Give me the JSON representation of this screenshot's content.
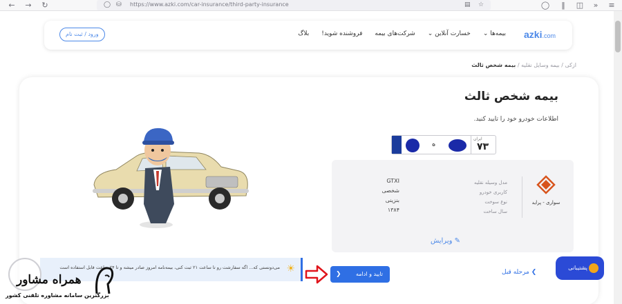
{
  "browser": {
    "url_display": "https://www.azki.com/car-insurance/third-party-insurance"
  },
  "header": {
    "logo_main": "azki",
    "logo_suffix": ".com",
    "menu": [
      {
        "label": "بیمه‌ها ⌄"
      },
      {
        "label": "خسارت آنلاین ⌄"
      },
      {
        "label": "شرکت‌های بیمه"
      },
      {
        "label": "فروشنده شوید!"
      },
      {
        "label": "بلاگ"
      }
    ],
    "login_label": "ورود / ثبت نام"
  },
  "breadcrumb": {
    "home": "ازکی",
    "sep1": " / ",
    "category": "بیمه وسایل نقلیه",
    "sep2": " / ",
    "current": "بیمه شخص ثالث"
  },
  "page": {
    "title": "بیمه شخص ثالث",
    "subtitle": "اطلاعات خودرو خود را تایید کنید."
  },
  "plate": {
    "code_label": "ایران",
    "code": "۷۳",
    "letter": "ه"
  },
  "vehicle": {
    "brand_name": "سواری - پراید",
    "specs": [
      {
        "label": "مدل وسیله نقلیه",
        "value": "GTXI"
      },
      {
        "label": "کاربری خودرو",
        "value": "شخصی"
      },
      {
        "label": "نوع سوخت",
        "value": "بنزینی"
      },
      {
        "label": "سال ساخت",
        "value": "۱۳۸۴"
      }
    ],
    "edit_label": "ویرایش"
  },
  "actions": {
    "confirm_label": "تایید و ادامه",
    "prev_label": "مرحله قبل",
    "support_label": "پشتیبانی"
  },
  "notice": {
    "text": "می‌دونستی که... اگه سفارشت رو تا ساعت ۲۱ ثبت کنی، بیمه‌نامه امروز صادر میشه و تا ۲۴ ساعت قابل استفاده است"
  },
  "watermark": {
    "title": "همراه مشاور",
    "subtitle": "بزرگترین سامانه مشاوره تلفنی کشور"
  },
  "colors": {
    "accent": "#2f6fe4",
    "brand_logo": "#4b88e8",
    "support": "#2b4ad6",
    "arrow": "#e0141b"
  }
}
